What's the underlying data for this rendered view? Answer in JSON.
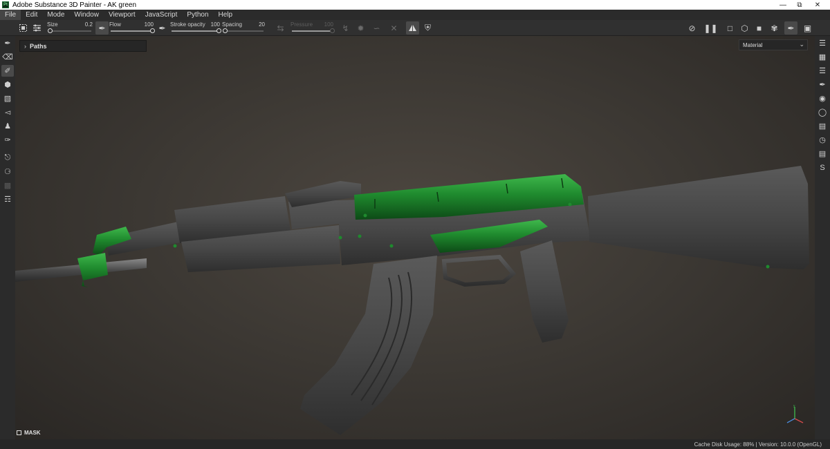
{
  "window": {
    "title": "Adobe Substance 3D Painter - AK green",
    "app_icon": "Pt"
  },
  "menu": [
    "File",
    "Edit",
    "Mode",
    "Window",
    "Viewport",
    "JavaScript",
    "Python",
    "Help"
  ],
  "toolbar": {
    "sliders": [
      {
        "label": "Size",
        "value": "0.2",
        "fraction": 0.04
      },
      {
        "label": "Flow",
        "value": "100",
        "fraction": 1.0
      },
      {
        "label": "Stroke opacity",
        "value": "100",
        "fraction": 1.0
      },
      {
        "label": "Spacing",
        "value": "20",
        "fraction": 0.03
      },
      {
        "label": "Pressure",
        "value": "100",
        "fraction": 1.0,
        "disabled": true
      }
    ]
  },
  "viewport": {
    "paths_label": "Paths",
    "display_mode": "Material",
    "mask_label": "MASK",
    "model_accent_color": "#1f8a2e",
    "model_base_color": "#474747"
  },
  "status": {
    "text": "Cache Disk Usage:   88% | Version: 10.0.0 (OpenGL)"
  }
}
